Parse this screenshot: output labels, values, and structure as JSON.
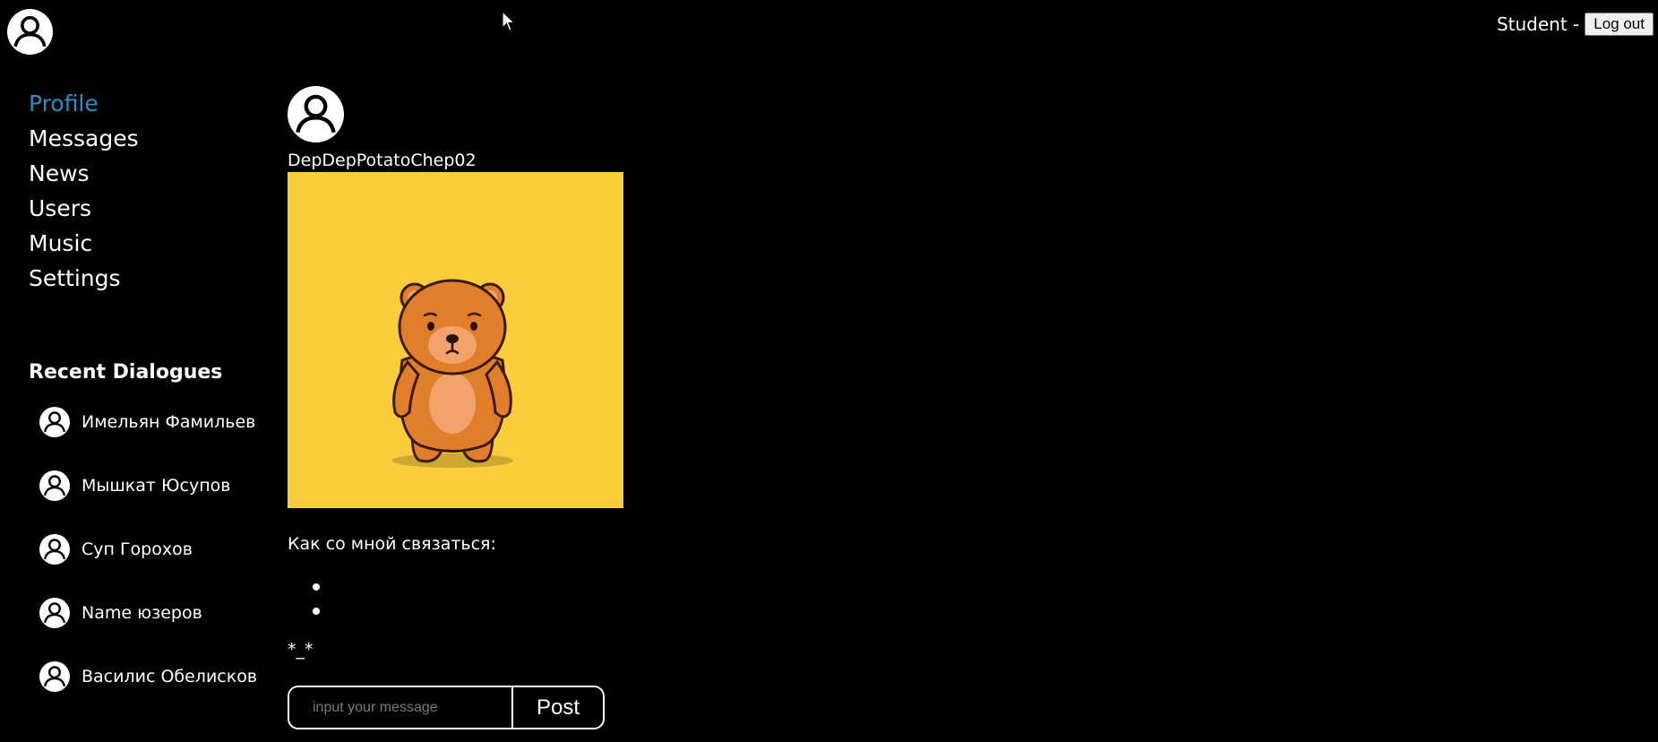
{
  "header": {
    "login_name": "Student -",
    "logout_label": "Log out"
  },
  "nav": {
    "items": [
      {
        "label": "Profile",
        "active": true
      },
      {
        "label": "Messages"
      },
      {
        "label": "News"
      },
      {
        "label": "Users"
      },
      {
        "label": "Music"
      },
      {
        "label": "Settings"
      }
    ]
  },
  "recent_dialogs": {
    "title": "Recent Dialogues",
    "items": [
      {
        "name": "Имельян Фамильев"
      },
      {
        "name": "Мышкат Юсупов"
      },
      {
        "name": "Суп Горохов"
      },
      {
        "name": "Name юзеров"
      },
      {
        "name": "Василис Обелисков"
      }
    ]
  },
  "profile": {
    "username": "DepDepPotatoChep02",
    "image_icon": "teddy-bear-illustration",
    "contacts_title": "Как со мной связаться:",
    "contacts": [
      "",
      ""
    ],
    "status": "*_*"
  },
  "post_form": {
    "placeholder": "input your message",
    "button_label": "Post"
  },
  "colors": {
    "background": "#000000",
    "accent": "#2b8dc2",
    "image_bg": "#facd3c"
  }
}
